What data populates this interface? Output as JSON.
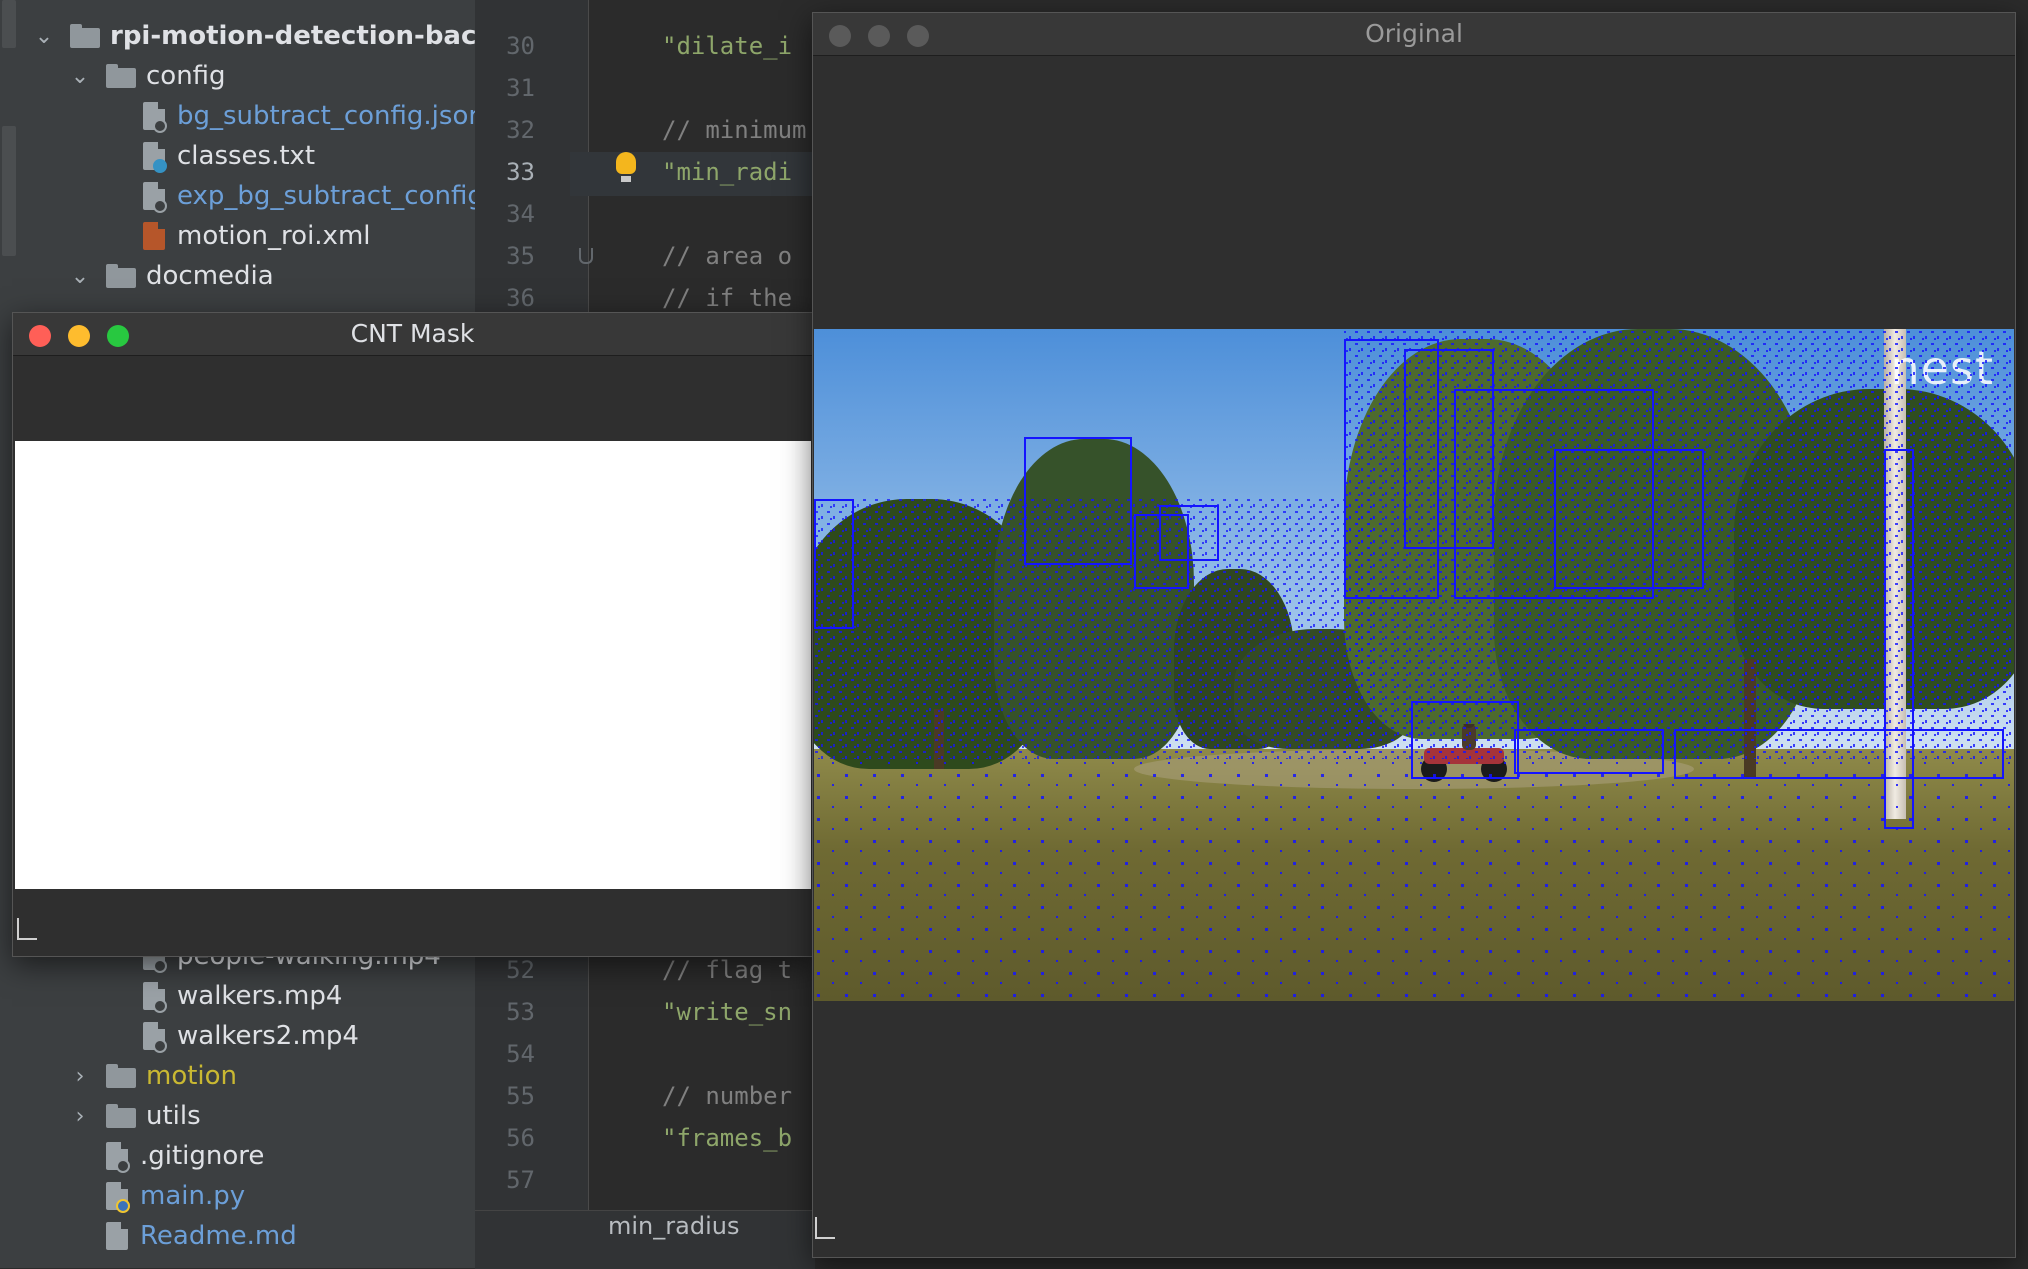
{
  "project_tree": {
    "items": [
      {
        "label": "rpi-motion-detection-backg"
      },
      {
        "label": "config"
      },
      {
        "label": "bg_subtract_config.json"
      },
      {
        "label": "classes.txt"
      },
      {
        "label": "exp_bg_subtract_config"
      },
      {
        "label": "motion_roi.xml"
      },
      {
        "label": "docmedia"
      },
      {
        "label": "people-walking.mp4"
      },
      {
        "label": "walkers.mp4"
      },
      {
        "label": "walkers2.mp4"
      },
      {
        "label": "motion"
      },
      {
        "label": "utils"
      },
      {
        "label": ".gitignore"
      },
      {
        "label": "main.py"
      },
      {
        "label": "Readme.md"
      }
    ]
  },
  "editor": {
    "lines": [
      {
        "num": "30",
        "text": "\"dilate_i"
      },
      {
        "num": "31",
        "text": ""
      },
      {
        "num": "32",
        "text": "// minimum"
      },
      {
        "num": "33",
        "text": "\"min_radi"
      },
      {
        "num": "34",
        "text": ""
      },
      {
        "num": "35",
        "text": "// area o"
      },
      {
        "num": "36",
        "text": "// if the"
      },
      {
        "num": "52",
        "text": "// flag t"
      },
      {
        "num": "53",
        "text": "\"write_sn"
      },
      {
        "num": "54",
        "text": ""
      },
      {
        "num": "55",
        "text": "// number"
      },
      {
        "num": "56",
        "text": "\"frames_b"
      },
      {
        "num": "57",
        "text": ""
      }
    ],
    "breadcrumb": "min_radius"
  },
  "windows": {
    "mask": {
      "title": "CNT Mask"
    },
    "original": {
      "title": "Original",
      "watermark": "nest"
    }
  },
  "colors": {
    "detection_box": "#1414ff",
    "traffic_red": "#ff5f57",
    "traffic_yellow": "#febc2e",
    "traffic_green": "#28c840",
    "traffic_inactive": "#5a5a5a"
  }
}
